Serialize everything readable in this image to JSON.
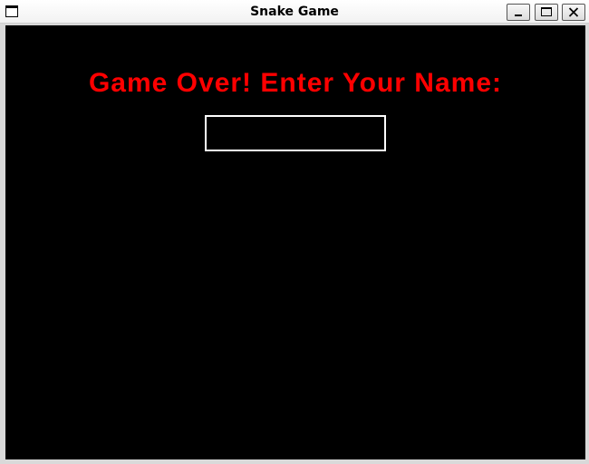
{
  "window": {
    "title": "Snake Game"
  },
  "icons": {
    "app": "window-icon",
    "minimize": "minimize-icon",
    "maximize": "maximize-icon",
    "close": "close-icon"
  },
  "game": {
    "message": "Game Over! Enter Your Name:",
    "message_color": "#ff0000",
    "background": "#000000",
    "name_input": {
      "value": "",
      "border_color": "#ffffff"
    }
  }
}
